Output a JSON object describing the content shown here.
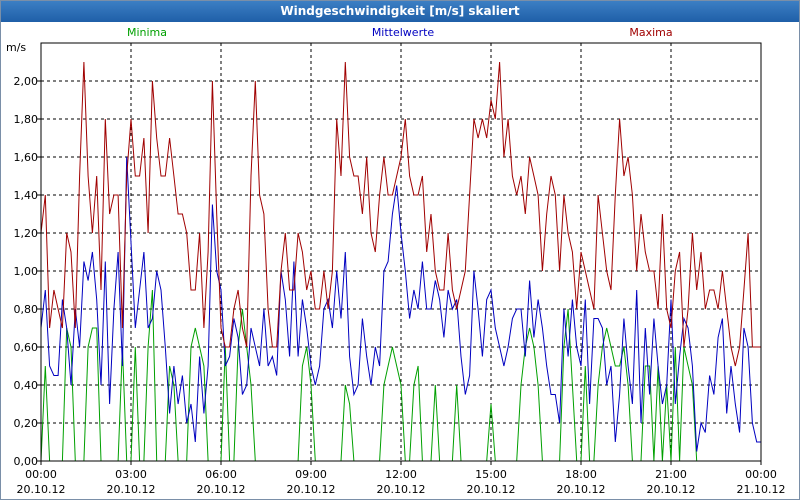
{
  "window": {
    "title": "Windgeschwindigkeit [m/s] skaliert"
  },
  "chart_data": {
    "type": "line",
    "title": "Windgeschwindigkeit [m/s] skaliert",
    "ylabel": "m/s",
    "xlabel": "",
    "ylim": [
      0,
      2.2
    ],
    "xlim": [
      0,
      24
    ],
    "grid": true,
    "legend_position": "top",
    "y_ticks": [
      0,
      0.2,
      0.4,
      0.6,
      0.8,
      1.0,
      1.2,
      1.4,
      1.6,
      1.8,
      2.0
    ],
    "y_tick_labels": [
      "0,00",
      "0,20",
      "0,40",
      "0,60",
      "0,80",
      "1,00",
      "1,20",
      "1,40",
      "1,60",
      "1,80",
      "2,00"
    ],
    "x_ticks": [
      0,
      3,
      6,
      9,
      12,
      15,
      18,
      21,
      24
    ],
    "x_tick_labels": [
      {
        "time": "00:00",
        "date": "20.10.12"
      },
      {
        "time": "03:00",
        "date": "20.10.12"
      },
      {
        "time": "06:00",
        "date": "20.10.12"
      },
      {
        "time": "09:00",
        "date": "20.10.12"
      },
      {
        "time": "12:00",
        "date": "20.10.12"
      },
      {
        "time": "15:00",
        "date": "20.10.12"
      },
      {
        "time": "18:00",
        "date": "20.10.12"
      },
      {
        "time": "21:00",
        "date": "20.10.12"
      },
      {
        "time": "00:00",
        "date": "21.10.12"
      }
    ],
    "x_step_hours": 0.1667,
    "series": [
      {
        "name": "Minima",
        "color": "#00a000",
        "values": [
          0.0,
          0.5,
          0.0,
          0.0,
          0.0,
          0.0,
          0.7,
          0.6,
          0.0,
          0.0,
          0.0,
          0.6,
          0.7,
          0.7,
          0.0,
          0.0,
          0.0,
          0.0,
          0.0,
          0.6,
          0.0,
          0.0,
          0.6,
          0.0,
          0.0,
          0.6,
          0.9,
          0.0,
          0.0,
          0.0,
          0.5,
          0.4,
          0.0,
          0.0,
          0.0,
          0.6,
          0.7,
          0.6,
          0.5,
          0.0,
          0.0,
          0.0,
          0.0,
          0.6,
          0.0,
          0.0,
          0.6,
          0.8,
          0.6,
          0.4,
          0.0,
          0.0,
          0.0,
          0.0,
          0.0,
          0.0,
          0.0,
          0.0,
          0.0,
          0.0,
          0.0,
          0.5,
          0.6,
          0.4,
          0.0,
          0.0,
          0.0,
          0.0,
          0.0,
          0.0,
          0.0,
          0.4,
          0.3,
          0.0,
          0.0,
          0.0,
          0.0,
          0.0,
          0.0,
          0.0,
          0.4,
          0.5,
          0.6,
          0.5,
          0.4,
          0.0,
          0.0,
          0.4,
          0.5,
          0.0,
          0.0,
          0.0,
          0.4,
          0.0,
          0.0,
          0.0,
          0.0,
          0.4,
          0.0,
          0.0,
          0.0,
          0.0,
          0.0,
          0.0,
          0.0,
          0.3,
          0.0,
          0.0,
          0.0,
          0.0,
          0.0,
          0.0,
          0.4,
          0.6,
          0.7,
          0.6,
          0.4,
          0.0,
          0.0,
          0.0,
          0.0,
          0.0,
          0.6,
          0.8,
          0.4,
          0.0,
          0.0,
          0.5,
          0.0,
          0.0,
          0.4,
          0.6,
          0.7,
          0.6,
          0.5,
          0.5,
          0.6,
          0.4,
          0.0,
          0.0,
          0.0,
          0.5,
          0.5,
          0.0,
          0.5,
          0.0,
          0.4,
          0.0,
          0.6,
          0.0,
          0.6,
          0.5,
          0.4,
          0.0,
          0.0,
          0.0,
          0.0,
          0.0,
          0.0,
          0.0,
          0.0,
          0.0,
          0.0,
          0.0,
          0.0,
          0.0,
          0.0,
          0.0,
          0.0
        ]
      },
      {
        "name": "Mittelwerte",
        "color": "#0000c0",
        "values": [
          0.7,
          0.9,
          0.5,
          0.45,
          0.45,
          0.85,
          0.7,
          0.4,
          0.8,
          0.6,
          1.05,
          0.95,
          1.1,
          0.85,
          0.4,
          1.05,
          0.3,
          0.8,
          1.1,
          0.5,
          1.6,
          1.15,
          0.7,
          0.9,
          1.1,
          0.7,
          0.75,
          1.0,
          0.9,
          0.6,
          0.25,
          0.5,
          0.3,
          0.45,
          0.2,
          0.3,
          0.1,
          0.55,
          0.25,
          0.5,
          1.35,
          1.0,
          0.9,
          0.5,
          0.55,
          0.75,
          0.65,
          0.35,
          0.4,
          0.7,
          0.6,
          0.5,
          0.8,
          0.5,
          0.55,
          0.45,
          1.0,
          0.85,
          0.55,
          1.05,
          0.55,
          0.85,
          0.7,
          0.5,
          0.4,
          0.5,
          0.8,
          0.85,
          0.7,
          1.0,
          0.75,
          1.1,
          0.55,
          0.35,
          0.4,
          0.75,
          0.55,
          0.4,
          0.6,
          0.5,
          1.0,
          1.05,
          1.3,
          1.45,
          1.2,
          1.0,
          0.75,
          0.9,
          0.8,
          1.05,
          0.8,
          0.8,
          0.95,
          0.85,
          0.65,
          0.9,
          0.8,
          0.85,
          0.55,
          0.35,
          0.45,
          1.0,
          0.8,
          0.55,
          0.85,
          0.9,
          0.7,
          0.6,
          0.5,
          0.6,
          0.75,
          0.8,
          0.8,
          0.55,
          0.95,
          0.65,
          0.85,
          0.7,
          0.5,
          0.35,
          0.35,
          0.2,
          0.8,
          0.55,
          0.85,
          0.6,
          0.5,
          0.85,
          0.3,
          0.75,
          0.75,
          0.7,
          0.4,
          0.5,
          0.1,
          0.35,
          0.75,
          0.5,
          0.3,
          0.9,
          0.2,
          0.7,
          0.35,
          0.75,
          0.5,
          0.3,
          0.4,
          0.85,
          0.3,
          0.55,
          0.75,
          0.7,
          0.5,
          0.05,
          0.2,
          0.15,
          0.45,
          0.35,
          0.65,
          0.75,
          0.25,
          0.5,
          0.3,
          0.15,
          0.7,
          0.6,
          0.2,
          0.1,
          0.1
        ]
      },
      {
        "name": "Maxima",
        "color": "#a00000",
        "values": [
          1.2,
          1.4,
          0.7,
          0.9,
          0.8,
          0.7,
          1.2,
          1.1,
          0.7,
          1.5,
          2.1,
          1.5,
          1.2,
          1.5,
          0.9,
          1.8,
          1.3,
          1.4,
          1.4,
          0.7,
          1.5,
          1.8,
          1.5,
          1.5,
          1.7,
          1.2,
          2.0,
          1.7,
          1.5,
          1.5,
          1.7,
          1.5,
          1.3,
          1.3,
          1.2,
          0.9,
          0.9,
          1.2,
          0.7,
          1.1,
          2.0,
          1.3,
          0.7,
          0.6,
          0.6,
          0.8,
          0.9,
          0.7,
          0.6,
          1.5,
          2.0,
          1.4,
          1.3,
          0.8,
          0.6,
          0.6,
          1.0,
          1.2,
          0.9,
          0.9,
          1.2,
          1.1,
          0.9,
          1.0,
          0.8,
          0.8,
          1.0,
          0.8,
          1.0,
          1.8,
          1.5,
          2.1,
          1.6,
          1.5,
          1.5,
          1.3,
          1.6,
          1.2,
          1.1,
          1.4,
          1.6,
          1.4,
          1.4,
          1.5,
          1.6,
          1.8,
          1.5,
          1.4,
          1.4,
          1.5,
          1.1,
          1.3,
          1.0,
          0.9,
          0.9,
          1.2,
          0.9,
          0.8,
          0.9,
          1.0,
          1.4,
          1.8,
          1.7,
          1.8,
          1.7,
          1.9,
          1.8,
          2.1,
          1.6,
          1.8,
          1.5,
          1.4,
          1.5,
          1.3,
          1.6,
          1.5,
          1.4,
          1.0,
          1.3,
          1.5,
          1.4,
          1.0,
          1.4,
          1.2,
          1.1,
          0.8,
          1.1,
          1.0,
          0.9,
          0.8,
          1.4,
          1.2,
          1.0,
          0.9,
          1.4,
          1.8,
          1.5,
          1.6,
          1.4,
          1.0,
          1.3,
          1.1,
          1.0,
          1.0,
          0.8,
          1.3,
          0.8,
          0.7,
          1.0,
          1.1,
          0.6,
          0.8,
          1.2,
          0.9,
          1.1,
          0.8,
          0.9,
          0.9,
          0.8,
          1.0,
          0.8,
          0.6,
          0.5,
          0.6,
          0.9,
          1.2,
          0.6,
          0.6,
          0.6
        ]
      }
    ]
  }
}
